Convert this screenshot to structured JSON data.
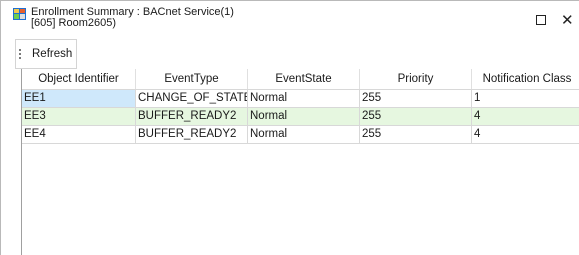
{
  "window": {
    "title_line1": "Enrollment Summary : BACnet Service(1)",
    "title_line2": "[605] Room2605)",
    "icon": "enrollment-summary-app-icon",
    "controls": {
      "maximize_icon": "maximize-icon",
      "close_glyph": "✕"
    }
  },
  "toolbar": {
    "refresh_label": "Refresh"
  },
  "grid": {
    "columns": [
      "Object Identifier",
      "EventType",
      "EventState",
      "Priority",
      "Notification Class"
    ],
    "rows": [
      {
        "object_identifier": "EE1",
        "event_type": "CHANGE_OF_STATE",
        "event_state": "Normal",
        "priority": "255",
        "notification_class": "1"
      },
      {
        "object_identifier": "EE3",
        "event_type": "BUFFER_READY2",
        "event_state": "Normal",
        "priority": "255",
        "notification_class": "4"
      },
      {
        "object_identifier": "EE4",
        "event_type": "BUFFER_READY2",
        "event_state": "Normal",
        "priority": "255",
        "notification_class": "4"
      }
    ],
    "selected_row": 0,
    "colors": {
      "alt_row": "#e6f7e0",
      "selected_cell": "#cfe8fb"
    }
  }
}
